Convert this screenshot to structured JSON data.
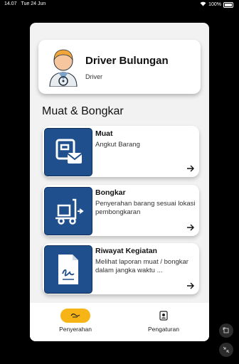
{
  "status_bar": {
    "time": "14.07",
    "date": "Tue 24 Jun",
    "battery": "100%"
  },
  "profile": {
    "name": "Driver Bulungan",
    "role": "Driver",
    "icon": "driver-avatar-icon"
  },
  "section": {
    "title": "Muat & Bongkar"
  },
  "menu": [
    {
      "title": "Muat",
      "desc": "Angkut Barang",
      "icon": "muat-box-envelope-icon"
    },
    {
      "title": "Bongkar",
      "desc": "Penyerahan barang sesuai lokasi pembongkaran",
      "icon": "hand-truck-icon"
    },
    {
      "title": "Riwayat Kegiatan",
      "desc": "Melihat laporan muat / bongkar dalam jangka waktu ...",
      "icon": "signed-document-icon"
    }
  ],
  "nav": [
    {
      "label": "Penyerahan",
      "icon": "handshake-icon",
      "active": true
    },
    {
      "label": "Pengaturan",
      "icon": "id-badge-icon",
      "active": false
    }
  ],
  "colors": {
    "accent": "#f7b417",
    "icon_bg": "#1f4f8d",
    "app_bg": "#f2f2f2"
  }
}
